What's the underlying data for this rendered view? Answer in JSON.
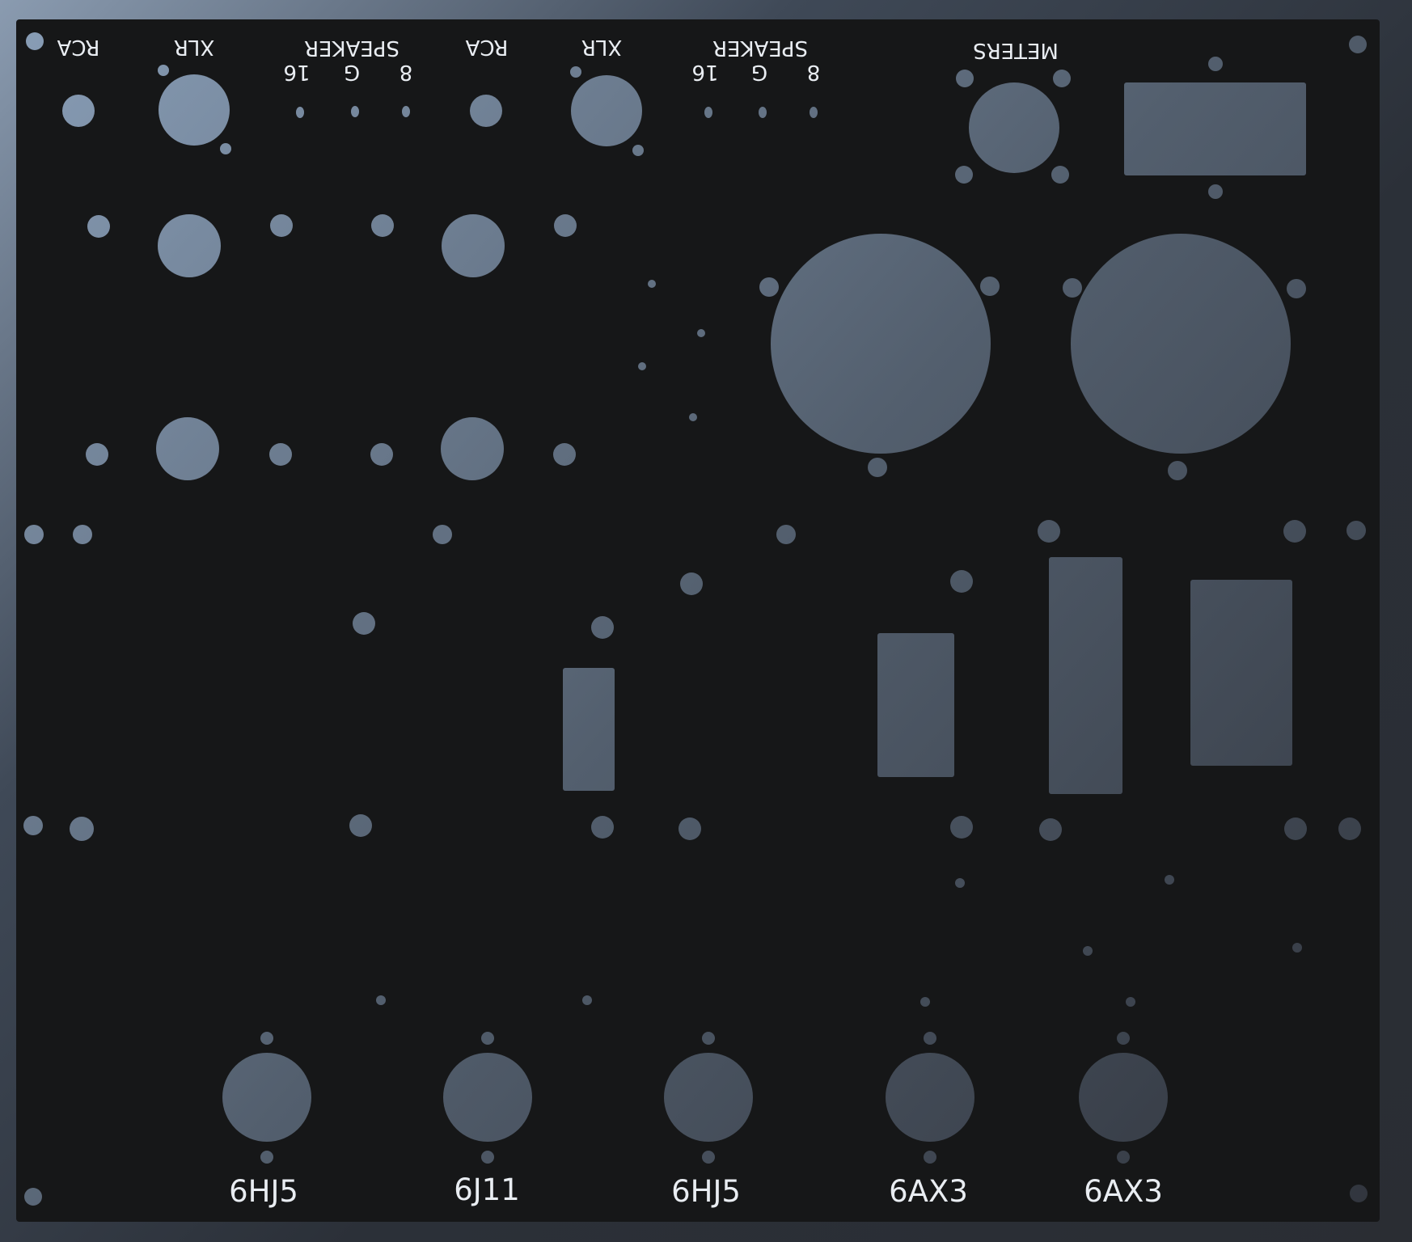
{
  "colors": {
    "panel": "#161718",
    "cutout_light": "#7f93aa",
    "cutout_dark": "#3a404a",
    "label": "#e9edf2"
  },
  "labels_mirrored": {
    "rca_left": "RCA",
    "xlr_left": "XLR",
    "speaker_left": "SPEAKER",
    "tap16_left": "16",
    "tapG_left": "G",
    "tap8_left": "8",
    "rca_right": "RCA",
    "xlr_right": "XLR",
    "speaker_right": "SPEAKER",
    "tap16_right": "16",
    "tapG_right": "G",
    "tap8_right": "8",
    "meters": "METERS"
  },
  "tube_labels": [
    "6HJ5",
    "6J11",
    "6HJ5",
    "6AX3",
    "6AX3"
  ]
}
